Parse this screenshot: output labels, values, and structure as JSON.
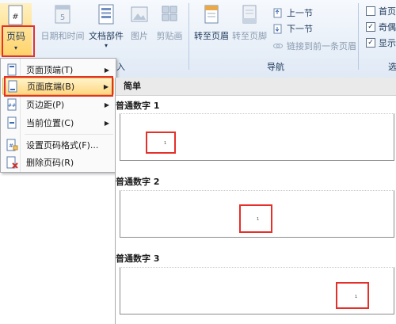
{
  "ribbon": {
    "page_number_label": "页码",
    "buttons": {
      "date_time": "日期和时间",
      "doc_parts": "文档部件",
      "picture": "图片",
      "clip_art": "剪贴画",
      "goto_header": "转至页眉",
      "goto_footer": "转至页脚"
    },
    "nav": {
      "prev": "上一节",
      "next": "下一节",
      "link_prev": "链接到前一条页眉",
      "group_label": "导航"
    },
    "options": {
      "first_page": "首页",
      "odd_even": "奇偶",
      "show": "显示"
    },
    "insert_group_tail": "入",
    "options_group_tail": "选"
  },
  "menu": {
    "items": [
      {
        "label": "页面顶端(T)",
        "has_submenu": true
      },
      {
        "label": "页面底端(B)",
        "has_submenu": true
      },
      {
        "label": "页边距(P)",
        "has_submenu": true
      },
      {
        "label": "当前位置(C)",
        "has_submenu": true
      },
      {
        "label": "设置页码格式(F)...",
        "has_submenu": false
      },
      {
        "label": "删除页码(R)",
        "has_submenu": false
      }
    ]
  },
  "gallery": {
    "header": "简单",
    "items": [
      {
        "title": "普通数字 1",
        "page_number": "1",
        "align": "left"
      },
      {
        "title": "普通数字 2",
        "page_number": "1",
        "align": "center"
      },
      {
        "title": "普通数字 3",
        "page_number": "1",
        "align": "right"
      }
    ]
  },
  "colors": {
    "highlight_box": "#e5302a",
    "menu_hover": "#ffd780",
    "ribbon_bg": "#dfe9f5"
  }
}
